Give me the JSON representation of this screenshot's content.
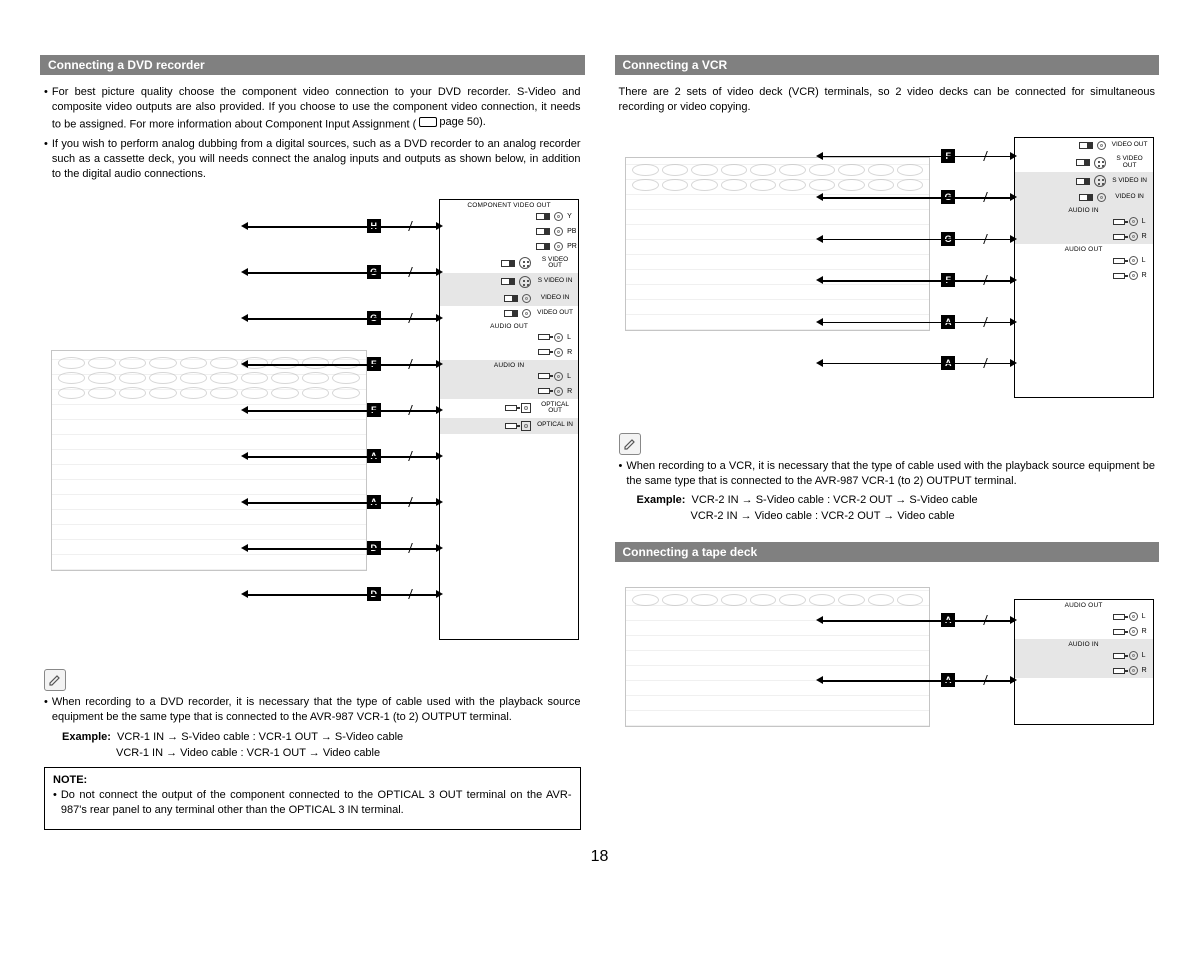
{
  "page_number": "18",
  "left": {
    "header": "Connecting a DVD recorder",
    "bullet1": "For best picture quality choose the component video connection to your DVD recorder. S-Video and composite video outputs are also provided. If you choose to use the component video connection, it needs to be assigned. For more information about Component Input Assignment (",
    "page_ref": "page 50).",
    "bullet2": "If you wish to perform analog dubbing from a digital sources, such as a DVD recorder to an analog recorder such as a cassette deck, you will needs connect the analog inputs and outputs as shown below, in addition to the digital audio connections.",
    "note_intro": "When recording to a DVD recorder, it is necessary that the type of cable used with the playback source equipment be the same type that is connected to the AVR-987 VCR-1 (to 2) OUTPUT terminal.",
    "example_label": "Example:",
    "example_line1": "VCR-1 IN → S-Video cable : VCR-1 OUT → S-Video cable",
    "example_line2": "VCR-1 IN → Video cable : VCR-1 OUT → Video cable",
    "notebox_head": "NOTE:",
    "notebox_text": "Do not connect the output of the component connected to the OPTICAL 3 OUT terminal on the AVR-987's rear panel to any terminal other than the OPTICAL 3 IN terminal.",
    "diagram": {
      "tags": [
        "H",
        "G",
        "G",
        "F",
        "F",
        "A",
        "A",
        "D",
        "D"
      ],
      "device_rows": [
        {
          "title": "COMPONENT VIDEO OUT",
          "labels": [
            "Y",
            "PB",
            "PR"
          ],
          "shaded": false,
          "type": "component"
        },
        {
          "title": "",
          "labels": [
            "S VIDEO OUT"
          ],
          "shaded": false,
          "type": "svideo"
        },
        {
          "title": "",
          "labels": [
            "S VIDEO IN"
          ],
          "shaded": true,
          "type": "svideo"
        },
        {
          "title": "",
          "labels": [
            "VIDEO IN"
          ],
          "shaded": true,
          "type": "video"
        },
        {
          "title": "",
          "labels": [
            "VIDEO OUT"
          ],
          "shaded": false,
          "type": "video"
        },
        {
          "title": "AUDIO OUT",
          "labels": [
            "L",
            "R"
          ],
          "shaded": false,
          "type": "audio"
        },
        {
          "title": "AUDIO IN",
          "labels": [
            "L",
            "R"
          ],
          "shaded": true,
          "type": "audio"
        },
        {
          "title": "",
          "labels": [
            "OPTICAL OUT"
          ],
          "shaded": false,
          "type": "optical"
        },
        {
          "title": "",
          "labels": [
            "OPTICAL IN"
          ],
          "shaded": true,
          "type": "optical"
        }
      ]
    }
  },
  "right": {
    "vcr_header": "Connecting a VCR",
    "vcr_intro": "There are 2 sets of video deck (VCR) terminals, so 2 video decks can be connected for simultaneous recording or video copying.",
    "vcr_note": "When recording to a VCR, it is necessary that the type of cable used with the playback source equipment be the same type that is connected to the AVR-987 VCR-1 (to 2) OUTPUT terminal.",
    "example_label": "Example:",
    "vcr_ex1": "VCR-2 IN → S-Video cable : VCR-2 OUT → S-Video cable",
    "vcr_ex2": "VCR-2 IN → Video cable : VCR-2 OUT → Video cable",
    "vcr_diagram": {
      "tags": [
        "F",
        "G",
        "G",
        "F",
        "A",
        "A"
      ],
      "device_rows": [
        {
          "title": "",
          "labels": [
            "VIDEO OUT"
          ],
          "shaded": false,
          "type": "video"
        },
        {
          "title": "",
          "labels": [
            "S VIDEO OUT"
          ],
          "shaded": false,
          "type": "svideo"
        },
        {
          "title": "",
          "labels": [
            "S VIDEO IN"
          ],
          "shaded": true,
          "type": "svideo"
        },
        {
          "title": "",
          "labels": [
            "VIDEO IN"
          ],
          "shaded": true,
          "type": "video"
        },
        {
          "title": "AUDIO IN",
          "labels": [
            "L",
            "R"
          ],
          "shaded": true,
          "type": "audio"
        },
        {
          "title": "AUDIO OUT",
          "labels": [
            "L",
            "R"
          ],
          "shaded": false,
          "type": "audio"
        }
      ]
    },
    "tape_header": "Connecting a tape deck",
    "tape_diagram": {
      "tags": [
        "A",
        "A"
      ],
      "device_rows": [
        {
          "title": "AUDIO OUT",
          "labels": [
            "L",
            "R"
          ],
          "shaded": false,
          "type": "audio"
        },
        {
          "title": "AUDIO IN",
          "labels": [
            "L",
            "R"
          ],
          "shaded": true,
          "type": "audio"
        }
      ]
    }
  }
}
